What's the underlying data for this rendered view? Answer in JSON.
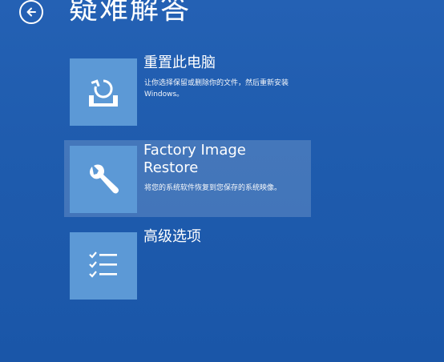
{
  "page": {
    "title": "疑难解答",
    "back_icon": "arrow-left-circle-icon"
  },
  "options": [
    {
      "title": "重置此电脑",
      "description": "让你选择保留或删除你的文件，然后重新安装 Windows。",
      "icon": "reset-pc-icon"
    },
    {
      "title": "Factory Image Restore",
      "description": "将您的系统软件恢复到您保存的系统映像。",
      "icon": "wrench-icon"
    },
    {
      "title": "高级选项",
      "description": "",
      "icon": "checklist-icon"
    }
  ],
  "colors": {
    "background": "#1f5cae",
    "tile": "#5c99d6",
    "text": "#ffffff"
  }
}
